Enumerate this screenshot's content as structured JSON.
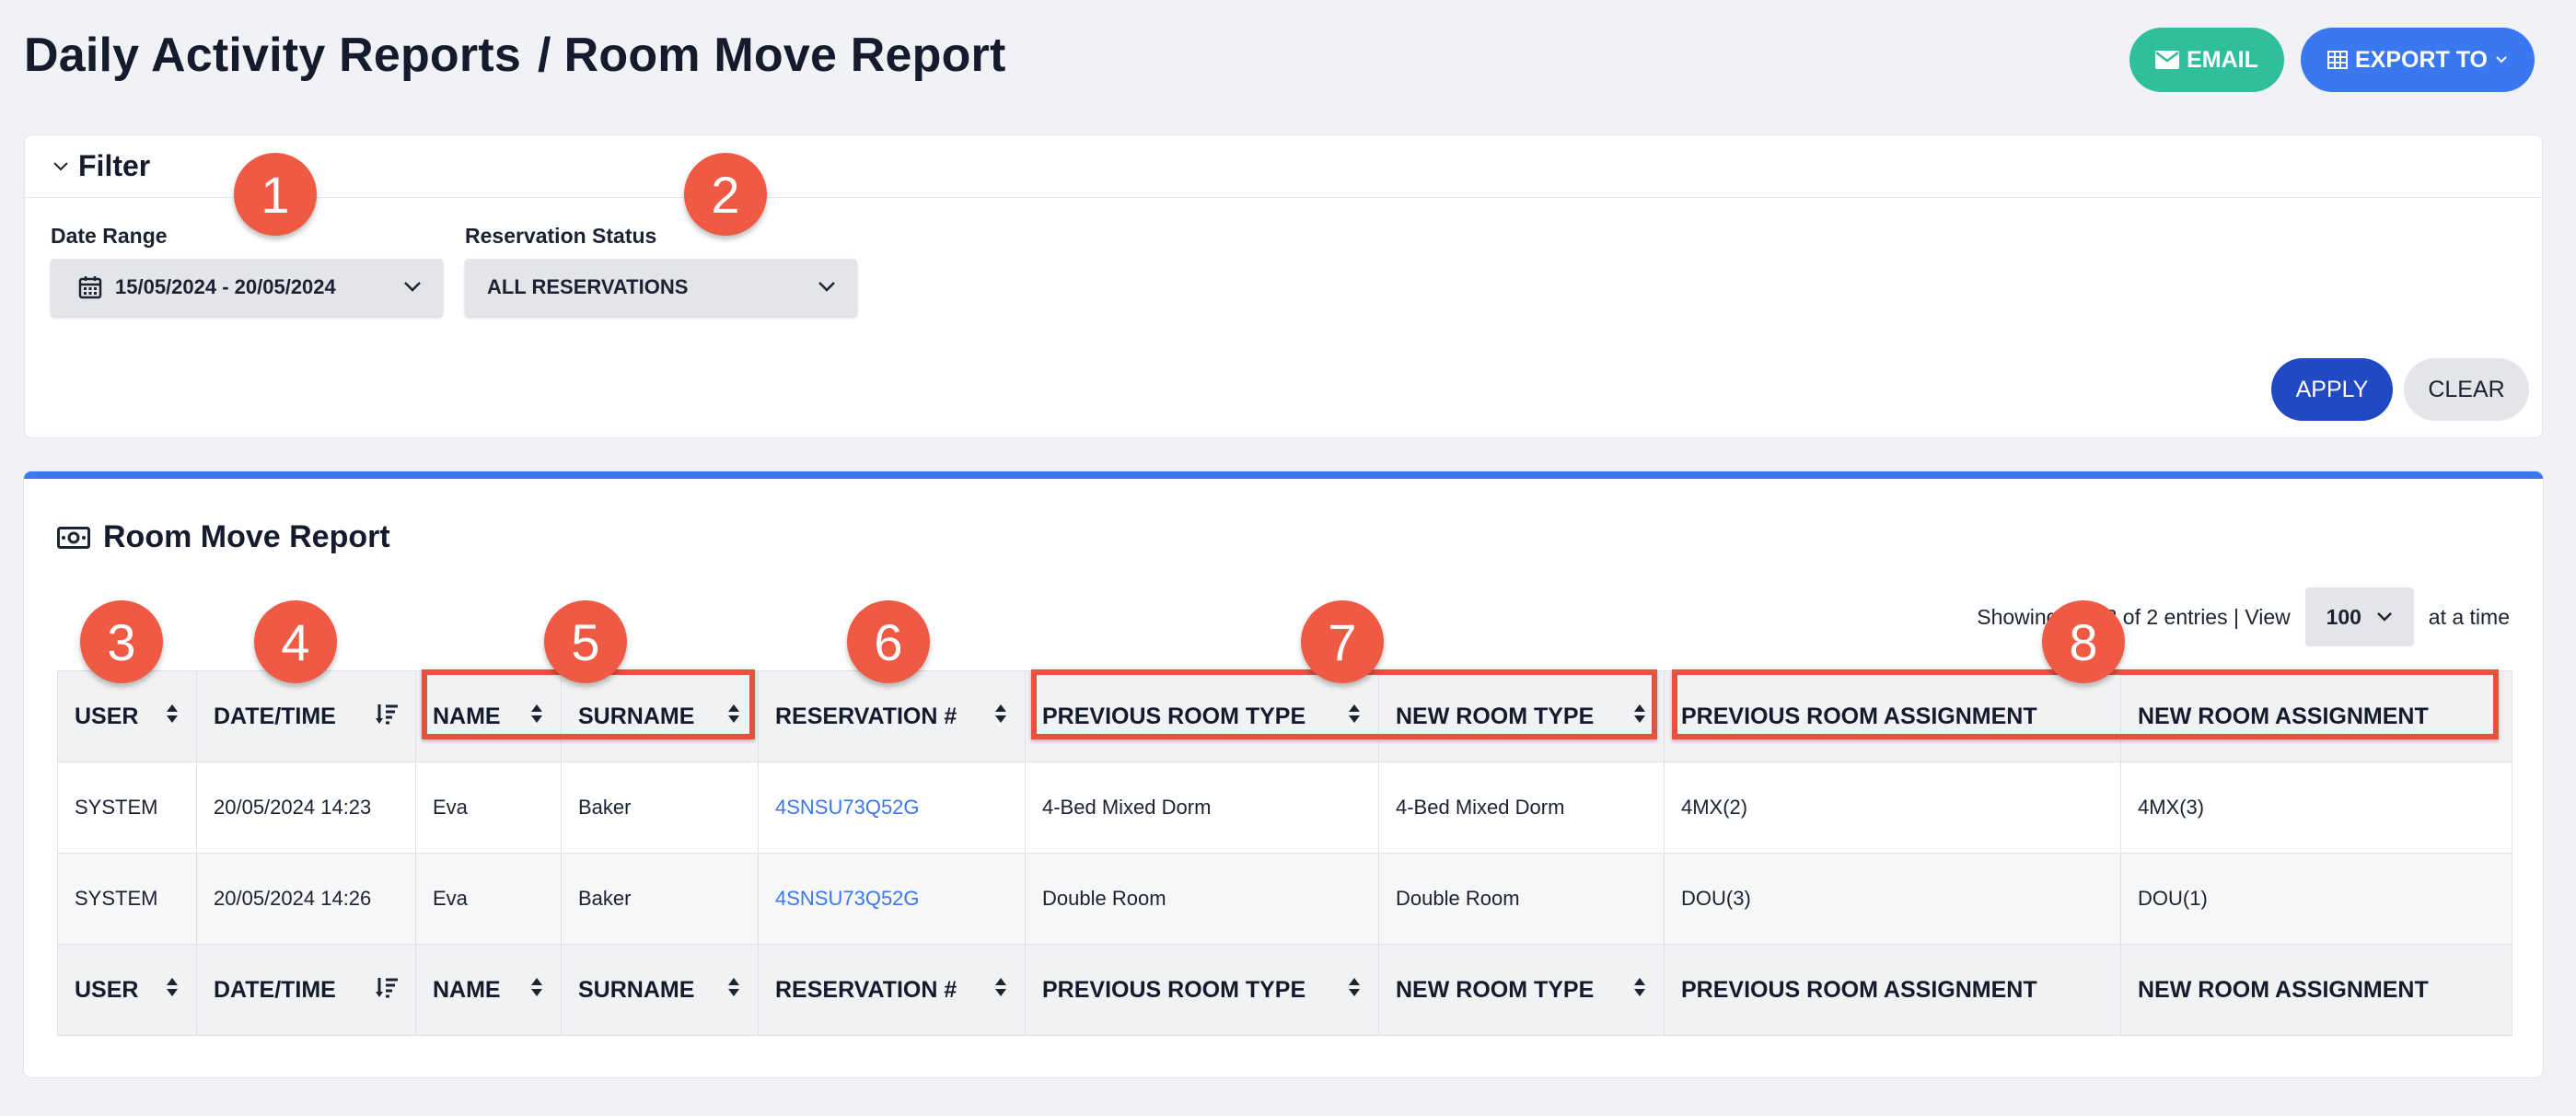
{
  "header": {
    "breadcrumb_parent": "Daily Activity Reports",
    "separator": "/",
    "page_title": "Room Move Report",
    "email_label": "EMAIL",
    "export_label": "EXPORT TO"
  },
  "filter": {
    "title": "Filter",
    "date_range_label": "Date Range",
    "date_range_value": "15/05/2024 - 20/05/2024",
    "reservation_status_label": "Reservation Status",
    "reservation_status_value": "ALL RESERVATIONS",
    "apply_label": "APPLY",
    "clear_label": "CLEAR"
  },
  "report": {
    "title": "Room Move Report",
    "showing_text": "Showing 1 to 2 of 2 entries | View",
    "page_size": "100",
    "at_a_time": "at a time",
    "columns": [
      "USER",
      "DATE/TIME",
      "NAME",
      "SURNAME",
      "RESERVATION #",
      "PREVIOUS ROOM TYPE",
      "NEW ROOM TYPE",
      "PREVIOUS ROOM ASSIGNMENT",
      "NEW ROOM ASSIGNMENT"
    ],
    "rows": [
      {
        "user": "SYSTEM",
        "datetime": "20/05/2024 14:23",
        "name": "Eva",
        "surname": "Baker",
        "reservation": "4SNSU73Q52G",
        "prev_room_type": "4-Bed Mixed Dorm",
        "new_room_type": "4-Bed Mixed Dorm",
        "prev_assignment": "4MX(2)",
        "new_assignment": "4MX(3)"
      },
      {
        "user": "SYSTEM",
        "datetime": "20/05/2024 14:26",
        "name": "Eva",
        "surname": "Baker",
        "reservation": "4SNSU73Q52G",
        "prev_room_type": "Double Room",
        "new_room_type": "Double Room",
        "prev_assignment": "DOU(3)",
        "new_assignment": "DOU(1)"
      }
    ]
  },
  "annotations": [
    "1",
    "2",
    "3",
    "4",
    "5",
    "6",
    "7",
    "8"
  ],
  "colors": {
    "email": "#2fbf9c",
    "export": "#3a78f2",
    "apply": "#2249c4",
    "marker": "#ef5a45",
    "link": "#3a78f2"
  }
}
